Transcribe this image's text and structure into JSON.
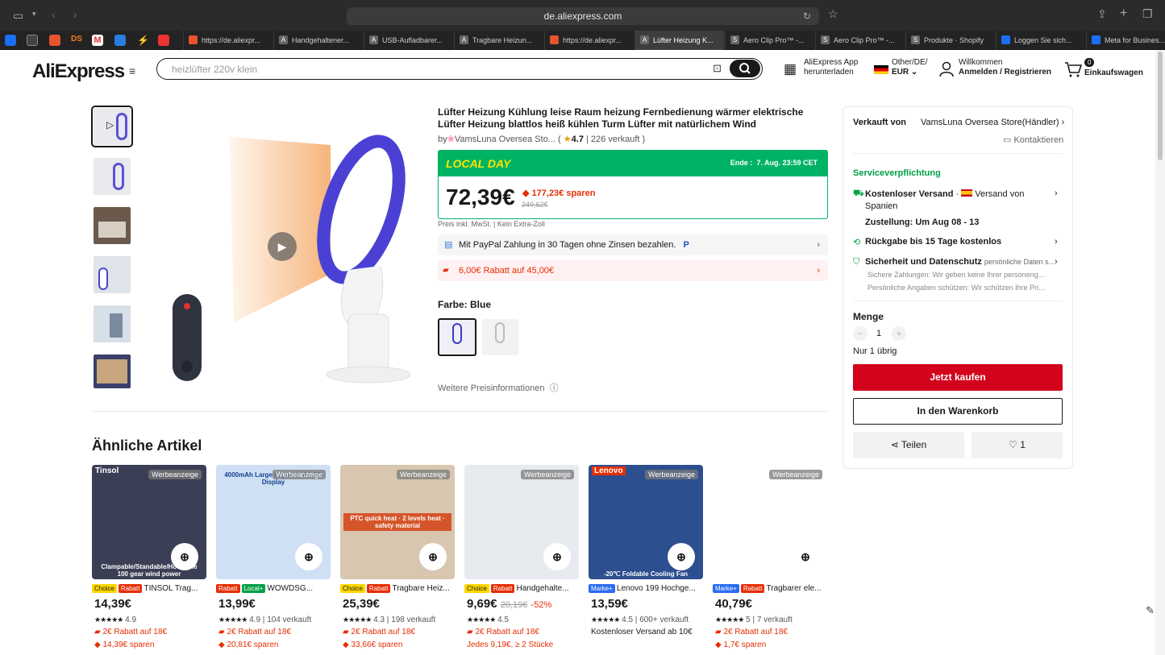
{
  "browser": {
    "url": "de.aliexpress.com",
    "tabs": [
      "https://de.aliexpr...",
      "Handgehaltener...",
      "USB-Aufladbarer...",
      "Tragbare Heizun...",
      "https://de.aliexpr...",
      "Lüfter Heizung K...",
      "Aero Clip Pro™ -...",
      "Aero Clip Pro™ -...",
      "Produkte · Shopify",
      "Loggen Sie sich...",
      "Meta for Busines..."
    ],
    "pinned": [
      "DS"
    ]
  },
  "header": {
    "logo": "AliExpress",
    "search_placeholder": "heizlüfter 220v klein",
    "app_line1": "AliExpress App",
    "app_line2": "herunterladen",
    "locale_line1": "Other/DE/",
    "locale_line2": "EUR",
    "welcome": "Willkommen",
    "login": "Anmelden / Registrieren",
    "cart_count": "0",
    "cart_label": "Einkaufswagen"
  },
  "product": {
    "title": "Lüfter Heizung Kühlung leise Raum heizung Fernbedienung wärmer elektrische Lüfter Heizung blattlos heiß kühlen Turm Lüfter mit natürlichem Wind",
    "by": "by",
    "store": "VamsLuna Oversea Sto...",
    "rating": "4.7",
    "sold": "226 verkauft",
    "local_day": "LOCAL DAY",
    "end_label": "Ende :",
    "end_time": "7. Aug. 23:59 CET",
    "price": "72,39€",
    "save": "177,23€ sparen",
    "old_price": "249,62€",
    "price_note": "Preis inkl. MwSt. | Kein Extra-Zoll",
    "paypal": "Mit PayPal Zahlung in 30 Tagen ohne Zinsen bezahlen.",
    "coupon": "6,00€ Rabatt auf 45,00€",
    "color_label": "Farbe: Blue",
    "more_price": "Weitere Preisinformationen"
  },
  "side": {
    "sold_by": "Verkauft von",
    "seller": "VamsLuna Oversea Store(Händler)",
    "contact": "Kontaktieren",
    "service": "Serviceverpflichtung",
    "free_ship": "Kostenloser Versand",
    "ship_from": "Versand von Spanien",
    "delivery": "Zustellung: Um Aug 08 - 13",
    "returns": "Rückgabe bis 15 Tage kostenlos",
    "security": "Sicherheit und Datenschutz",
    "security_sub": "persönliche Daten s...",
    "sec1": "Sichere Zahlungen: Wir geben keine Ihrer personeng...",
    "sec2": "Persönliche Angaben schützen: Wir schützen Ihre Pri...",
    "qty_label": "Menge",
    "qty": "1",
    "stock": "Nur 1 übrig",
    "buy": "Jetzt kaufen",
    "cart": "In den Warenkorb",
    "share": "Teilen",
    "likes": "1"
  },
  "similar": {
    "title": "Ähnliche Artikel",
    "ad": "Werbeanzeige",
    "items": [
      {
        "tags": [
          "Choice",
          "Rabatt"
        ],
        "name": "TINSOL Trag...",
        "price": "14,39€",
        "rating": "4.9",
        "sold": "",
        "l1": "2€ Rabatt auf 18€",
        "l2": "14,39€ sparen",
        "banner": "Clampable/Standable/Hookable 100 gear wind power",
        "brand": "Tinsol"
      },
      {
        "tags": [
          "Rabatt",
          "Local+"
        ],
        "name": "WOWDSG...",
        "price": "13,99€",
        "rating": "4.9",
        "sold": "104 verkauft",
        "l1": "2€ Rabatt auf 18€",
        "l2": "20,81€ sparen",
        "banner": "4000mAh Large Capacity & LED Display",
        "brand": ""
      },
      {
        "tags": [
          "Choice",
          "Rabatt"
        ],
        "name": "Tragbare Heiz...",
        "price": "25,39€",
        "rating": "4.3",
        "sold": "198 verkauft",
        "l1": "2€ Rabatt auf 18€",
        "l2": "33,66€ sparen",
        "banner": "PTC quick heat · 2 levels heat · safety material",
        "brand": ""
      },
      {
        "tags": [
          "Choice",
          "Rabatt"
        ],
        "name": "Handgehalte...",
        "price": "9,69€",
        "rating": "4.5",
        "sold": "",
        "old": "20,19€",
        "pct": "-52%",
        "l1": "2€ Rabatt auf 18€",
        "l2": "Jedes 9,19€, ≥ 2 Stücke",
        "banner": "",
        "brand": ""
      },
      {
        "tags": [
          "Marke+"
        ],
        "name": "Lenovo 199 Hochge...",
        "price": "13,59€",
        "rating": "4.5",
        "sold": "600+ verkauft",
        "l1": "Kostenloser Versand ab 10€",
        "l2": "",
        "banner": "-20℃ Foldable Cooling Fan",
        "brand": "Lenovo"
      },
      {
        "tags": [
          "Marke+",
          "Rabatt"
        ],
        "name": "Tragbarer ele...",
        "price": "40,79€",
        "rating": "5",
        "sold": "7 verkauft",
        "l1": "2€ Rabatt auf 18€",
        "l2": "1,7€ sparen",
        "banner": "",
        "brand": ""
      }
    ]
  }
}
